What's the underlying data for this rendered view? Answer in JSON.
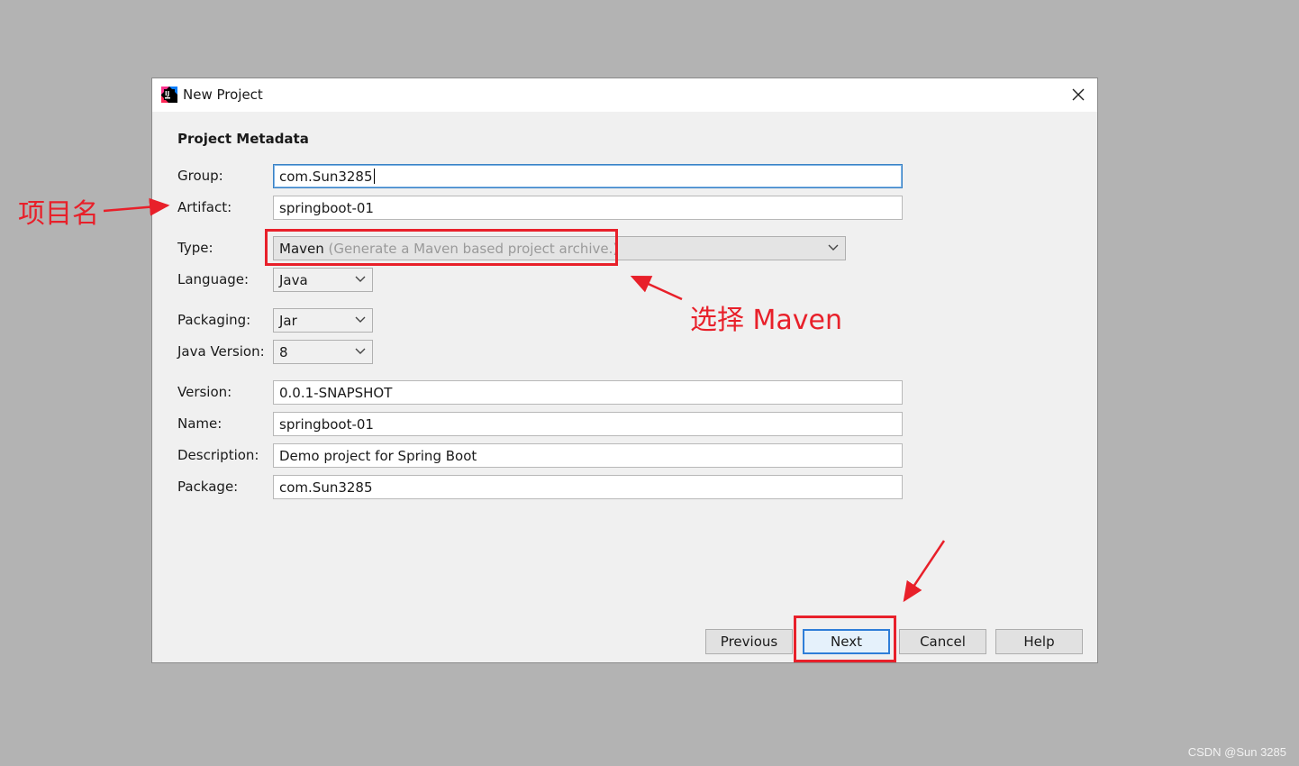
{
  "window": {
    "title": "New Project",
    "app_icon": "intellij-idea-icon",
    "close_icon": "close-icon"
  },
  "section_title": "Project Metadata",
  "fields": {
    "group": {
      "label": "Group:",
      "value": "com.Sun3285"
    },
    "artifact": {
      "label": "Artifact:",
      "value": "springboot-01"
    },
    "type": {
      "label": "Type:",
      "value": "Maven",
      "hint": "(Generate a Maven based project archive.)"
    },
    "language": {
      "label": "Language:",
      "value": "Java"
    },
    "packaging": {
      "label": "Packaging:",
      "value": "Jar"
    },
    "java_version": {
      "label": "Java Version:",
      "value": "8"
    },
    "version": {
      "label": "Version:",
      "value": "0.0.1-SNAPSHOT"
    },
    "name": {
      "label": "Name:",
      "value": "springboot-01"
    },
    "description": {
      "label": "Description:",
      "value": "Demo project for Spring Boot"
    },
    "package": {
      "label": "Package:",
      "value": "com.Sun3285"
    }
  },
  "buttons": {
    "previous": "Previous",
    "next": "Next",
    "cancel": "Cancel",
    "help": "Help"
  },
  "annotations": {
    "artifact_note": "项目名",
    "type_note": "选择 Maven",
    "color": "#e8202a"
  },
  "watermark": "CSDN @Sun 3285"
}
